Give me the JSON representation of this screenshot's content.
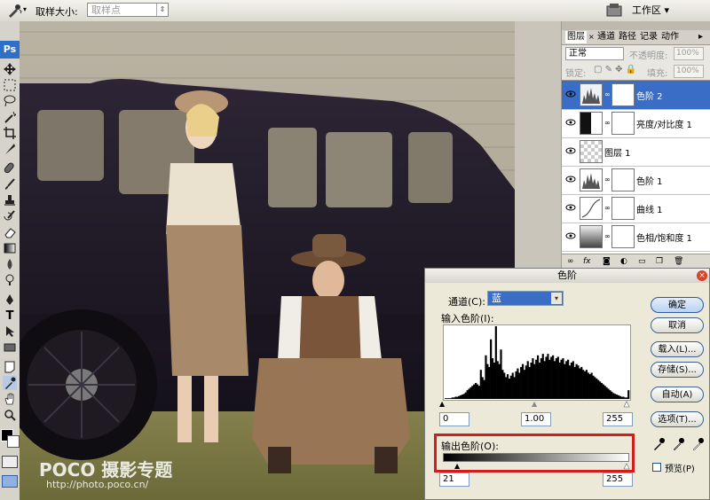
{
  "options_bar": {
    "sample_size_label": "取样大小:",
    "sample_size_value": "取样点",
    "workspace_label": "工作区 ▾"
  },
  "toolbox": {
    "ps_label": "Ps"
  },
  "layers_panel": {
    "tabs": [
      "图层",
      "通道",
      "路径",
      "记录",
      "动作"
    ],
    "blend_mode": "正常",
    "opacity_label": "不透明度:",
    "opacity_value": "100%",
    "lock_label": "锁定:",
    "fill_label": "填充:",
    "fill_value": "100%",
    "layers": [
      {
        "name": "色阶 2",
        "selected": true
      },
      {
        "name": "亮度/对比度 1",
        "selected": false
      },
      {
        "name": "图层 1",
        "selected": false
      },
      {
        "name": "色阶 1",
        "selected": false
      },
      {
        "name": "曲线 1",
        "selected": false
      },
      {
        "name": "色相/饱和度 1",
        "selected": false
      }
    ]
  },
  "levels_dialog": {
    "title": "色阶",
    "channel_label": "通道(C):",
    "channel_value": "蓝",
    "input_levels_label": "输入色阶(I):",
    "input_black": "0",
    "input_gamma": "1.00",
    "input_white": "255",
    "output_levels_label": "输出色阶(O):",
    "output_black": "21",
    "output_white": "255",
    "buttons": {
      "ok": "确定",
      "cancel": "取消",
      "load": "载入(L)...",
      "save": "存储(S)...",
      "auto": "自动(A)",
      "options": "选项(T)..."
    },
    "preview_label": "预览(P)",
    "preview_checked": false,
    "histogram": [
      1,
      1,
      1,
      1,
      2,
      2,
      3,
      3,
      4,
      5,
      6,
      7,
      9,
      12,
      14,
      16,
      18,
      20,
      22,
      20,
      18,
      40,
      30,
      26,
      60,
      48,
      44,
      82,
      56,
      50,
      100,
      52,
      48,
      68,
      40,
      36,
      30,
      34,
      28,
      32,
      36,
      30,
      38,
      42,
      36,
      44,
      48,
      40,
      46,
      52,
      44,
      50,
      56,
      48,
      54,
      60,
      50,
      56,
      62,
      52,
      58,
      62,
      54,
      58,
      60,
      52,
      56,
      58,
      50,
      54,
      56,
      48,
      52,
      54,
      46,
      50,
      52,
      44,
      48,
      46,
      42,
      44,
      40,
      38,
      40,
      36,
      34,
      36,
      32,
      30,
      28,
      26,
      24,
      22,
      20,
      18,
      16,
      14,
      12,
      10,
      8,
      7,
      6,
      5,
      4,
      3,
      3,
      2,
      2,
      12
    ]
  },
  "watermark": {
    "brand": "POCO 摄影专题",
    "url": "http://photo.poco.cn/"
  },
  "colors": {
    "selection_blue": "#3a6dc5",
    "highlight_red": "#d41c1c"
  }
}
